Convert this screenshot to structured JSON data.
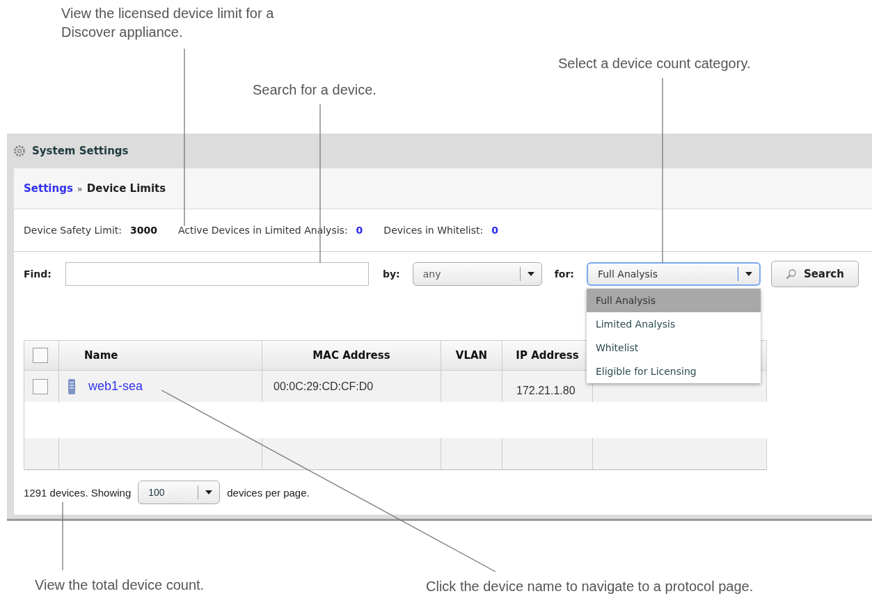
{
  "callouts": [
    {
      "text": "View the licensed device limit for a Discover appliance."
    },
    {
      "text": "Search for a device."
    },
    {
      "text": "Select a device count category."
    },
    {
      "text": "View the total device count."
    },
    {
      "text": "Click the device name to navigate to a protocol page."
    }
  ],
  "window": {
    "title": "System Settings"
  },
  "breadcrumb": {
    "link": "Settings",
    "separator": "»",
    "current": "Device Limits"
  },
  "stats": [
    {
      "label": "Device Safety Limit:",
      "value": "3000",
      "kind": "plain"
    },
    {
      "label": "Active Devices in Limited Analysis:",
      "value": "0",
      "kind": "link"
    },
    {
      "label": "Devices in Whitelist:",
      "value": "0",
      "kind": "link"
    }
  ],
  "search": {
    "find_label": "Find:",
    "by_label": "by:",
    "by_value": "any",
    "for_label": "for:",
    "for_value": "Full Analysis",
    "for_expanded": true,
    "button": "Search",
    "for_options": [
      {
        "label": "Full Analysis",
        "selected": true
      },
      {
        "label": "Limited Analysis",
        "selected": false
      },
      {
        "label": "Whitelist",
        "selected": false
      },
      {
        "label": "Eligible for Licensing",
        "selected": false
      }
    ]
  },
  "table": {
    "header_checked": false,
    "columns": [
      "Name",
      "MAC Address",
      "VLAN",
      "IP Address"
    ],
    "rows": [
      {
        "checked": false,
        "name": "web1-sea",
        "mac": "00:0C:29:CD:CF:D0",
        "ip": "172.21.1.80"
      }
    ]
  },
  "footer": {
    "count": "1291 devices. Showing",
    "per_page": "100",
    "suffix": "devices per page."
  }
}
